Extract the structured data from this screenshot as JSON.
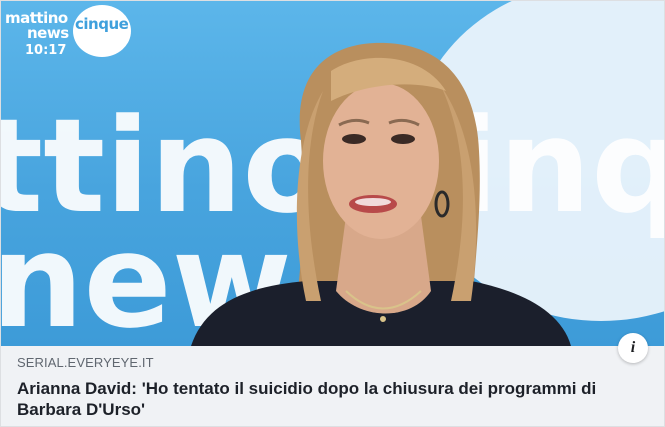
{
  "link_preview": {
    "image": {
      "logo_line1": "mattino",
      "logo_circle_text": "cinque",
      "logo_line2": "news",
      "logo_time": "10:17",
      "backdrop_text_line1": "ttino  cinq",
      "backdrop_text_line2": "new",
      "description": "News presenter in studio"
    },
    "domain": "SERIAL.EVERYEYE.IT",
    "headline": "Arianna David: 'Ho tentato il suicidio dopo la chiusura dei programmi di Barbara D'Urso'",
    "info_icon": "info-icon"
  },
  "colors": {
    "backdrop_blue": "#48a4de",
    "caption_bg": "#f0f2f5",
    "domain_text": "#606770",
    "headline_text": "#1d2129"
  }
}
